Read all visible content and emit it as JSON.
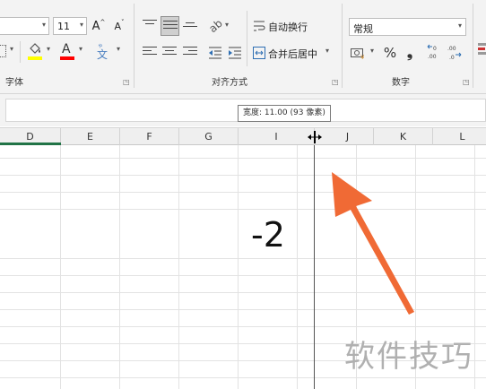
{
  "ribbon": {
    "font_size": "11",
    "grow_font": "A",
    "shrink_font": "A",
    "font_group_label": "字体",
    "wrap_text_label": "自动换行",
    "merge_center_label": "合并后居中",
    "alignment_group_label": "对齐方式",
    "number_format_value": "常规",
    "percent_symbol": "%",
    "comma_symbol": "❟",
    "number_group_label": "数字",
    "fill_color": "#ffff00",
    "font_color": "#ff0000",
    "phonetic_glyph": "文",
    "font_color_glyph": "A"
  },
  "tooltip": {
    "text": "宽度: 11.00 (93 像素)"
  },
  "columns": [
    "D",
    "E",
    "F",
    "G",
    "I",
    "J",
    "K",
    "L"
  ],
  "cell": {
    "value": "-2"
  },
  "watermark": "软件技巧",
  "colors": {
    "arrow": "#f06a35",
    "selected_column_bar": "#217346"
  }
}
